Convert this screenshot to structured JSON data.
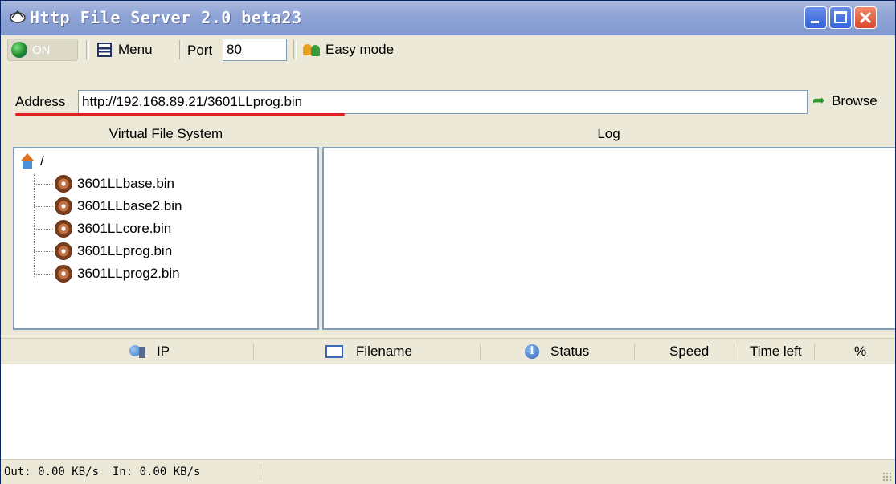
{
  "window": {
    "title": "Http File Server 2.0 beta23"
  },
  "toolbar": {
    "on_label": "ON",
    "menu_label": "Menu",
    "port_label": "Port",
    "port_value": "80",
    "easy_mode_label": "Easy mode"
  },
  "address": {
    "label": "Address",
    "value": "http://192.168.89.21/3601LLprog.bin",
    "browse_label": "Browse"
  },
  "panels": {
    "vfs_header": "Virtual File System",
    "log_header": "Log"
  },
  "tree": {
    "root": "/",
    "files": [
      "3601LLbase.bin",
      "3601LLbase2.bin",
      "3601LLcore.bin",
      "3601LLprog.bin",
      "3601LLprog2.bin"
    ]
  },
  "grid": {
    "columns": [
      "IP",
      "Filename",
      "Status",
      "Speed",
      "Time left",
      "%"
    ]
  },
  "status": {
    "text": "Out: 0.00 KB/s  In: 0.00 KB/s"
  },
  "icons": {
    "title": "hfs-app-icon",
    "on": "globe-icon",
    "menu": "menu-icon",
    "easy": "users-icon",
    "browse": "browse-arrow-icon",
    "root": "home-icon",
    "file": "file-item-icon",
    "ip": "computer-icon",
    "filename": "window-icon",
    "status": "info-icon"
  },
  "colors": {
    "titlebar": "#8fa4d6",
    "accent_underline": "#e02020",
    "panel_border": "#7f9db9"
  }
}
